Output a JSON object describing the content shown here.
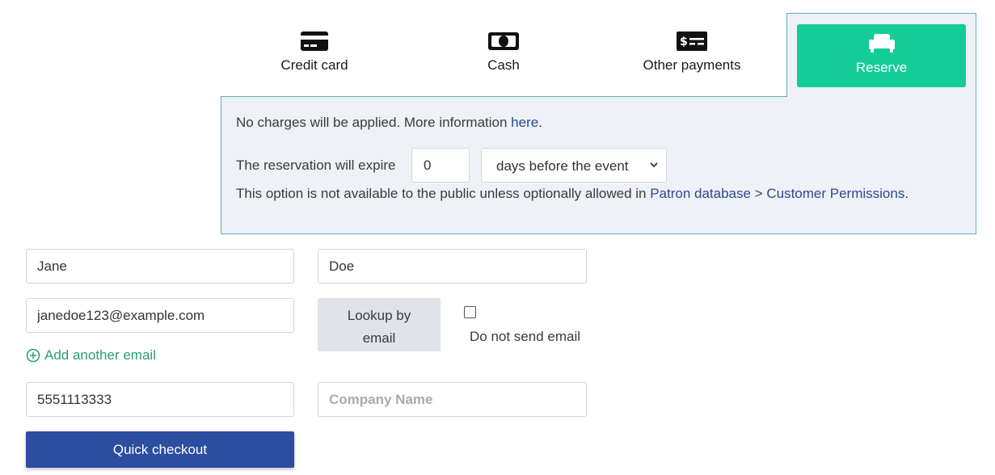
{
  "tabs": {
    "credit_card": {
      "label": "Credit card",
      "icon": "credit-card-icon"
    },
    "cash": {
      "label": "Cash",
      "icon": "cash-icon"
    },
    "other": {
      "label": "Other payments",
      "icon": "check-icon"
    },
    "reserve": {
      "label": "Reserve",
      "icon": "armchair-icon",
      "color": "#14cc97"
    }
  },
  "reserve_panel": {
    "info_text": "No charges will be applied. More information ",
    "info_link": "here",
    "info_end": ".",
    "expire_label": "The reservation will expire",
    "expire_value": "0",
    "expire_unit": "days before the event",
    "note_text": "This option is not available to the public unless optionally allowed in ",
    "note_link": "Patron database > Customer Permissions",
    "note_end": "."
  },
  "form": {
    "first_name": "Jane",
    "last_name": "Doe",
    "email": "janedoe123@example.com",
    "lookup_label_1": "Lookup by",
    "lookup_label_2": "email",
    "no_email_label": "Do not send email",
    "add_email_label": "Add another email",
    "phone": "5551113333",
    "company_placeholder": "Company Name",
    "submit_label": "Quick checkout"
  },
  "colors": {
    "accent": "#14cc97",
    "primary": "#2b4ea0",
    "link": "#2c4a8c",
    "add_link": "#2a9d74"
  }
}
